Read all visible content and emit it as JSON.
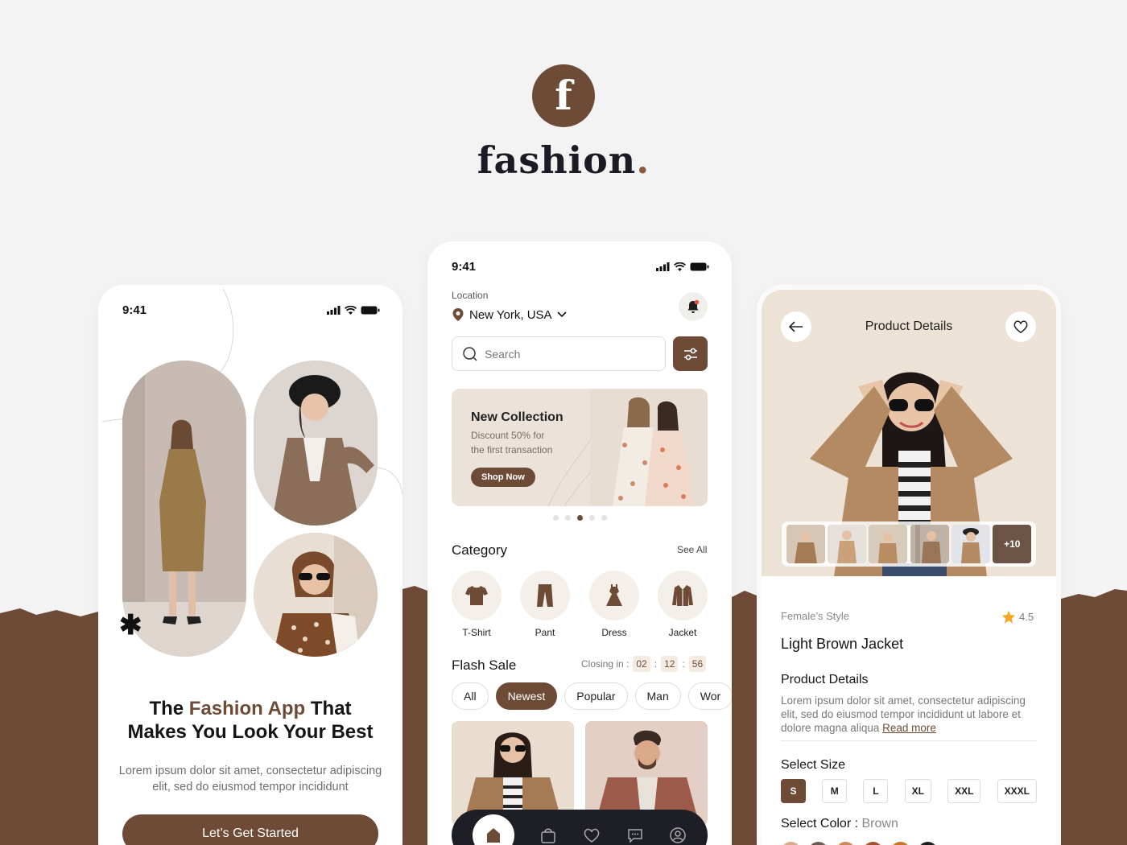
{
  "brand": {
    "mark": "f",
    "name": "fashion",
    "dot": ".",
    "colors": {
      "primary": "#6e4b36",
      "background": "#f3f3f3",
      "dark": "#1d1e26"
    }
  },
  "onboarding": {
    "time": "9:41",
    "title_before": "The ",
    "title_highlight": "Fashion App",
    "title_after": " That",
    "title_line2": "Makes You Look Your Best",
    "description": "Lorem ipsum dolor sit amet, consectetur adipiscing elit, sed do eiusmod tempor incididunt",
    "cta": "Let’s Get Started",
    "asterisk": "✱"
  },
  "home": {
    "time": "9:41",
    "location_label": "Location",
    "location_value": "New York, USA",
    "search_placeholder": "Search",
    "banner": {
      "title": "New Collection",
      "subtitle_1": "Discount 50% for",
      "subtitle_2": "the first transaction",
      "button": "Shop Now"
    },
    "category_title": "Category",
    "see_all": "See All",
    "categories": [
      {
        "label": "T-Shirt",
        "icon": "tshirt-icon"
      },
      {
        "label": "Pant",
        "icon": "pant-icon"
      },
      {
        "label": "Dress",
        "icon": "dress-icon"
      },
      {
        "label": "Jacket",
        "icon": "jacket-icon"
      }
    ],
    "flash_sale": "Flash Sale",
    "closing_in": "Closing in :",
    "timer": [
      "02",
      "12",
      "56"
    ],
    "filters": [
      "All",
      "Newest",
      "Popular",
      "Man",
      "Wor"
    ],
    "active_filter": "Newest"
  },
  "details": {
    "header_title": "Product Details",
    "thumb_more": "+10",
    "style": "Female’s Style",
    "rating": "4.5",
    "product_name": "Light Brown Jacket",
    "section_title": "Product Details",
    "description": "Lorem ipsum dolor sit amet, consectetur adipiscing elit, sed do eiusmod tempor incididunt ut labore et dolore magna aliqua ",
    "read_more": "Read more",
    "select_size": "Select Size",
    "sizes": [
      "S",
      "M",
      "L",
      "XL",
      "XXL",
      "XXXL"
    ],
    "selected_size": "S",
    "select_color": "Select Color : ",
    "color_value": "Brown",
    "swatches": [
      "#d9a98a",
      "#6f5a52",
      "#c98a5c",
      "#a0522d",
      "#c4782c",
      "#1f1f1f"
    ]
  }
}
